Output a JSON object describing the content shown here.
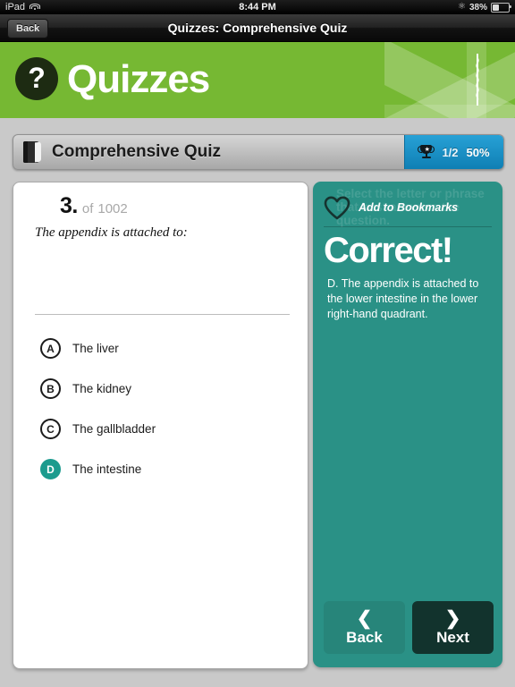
{
  "statusbar": {
    "device": "iPad",
    "wifi_icon": "wifi-icon",
    "time": "8:44 PM",
    "bluetooth_icon": "bluetooth-icon",
    "battery_percent": "38%"
  },
  "navbar": {
    "back_label": "Back",
    "title": "Quizzes: Comprehensive Quiz"
  },
  "brand": {
    "icon": "question-mark-icon",
    "icon_glyph": "?",
    "title": "Quizzes",
    "decoration_icon": "rod-of-asclepius-icon",
    "green": "#76b833"
  },
  "quizbar": {
    "book_icon": "book-icon",
    "name": "Comprehensive Quiz",
    "trophy_icon": "trophy-icon",
    "score_fraction": "1/2",
    "score_percent": "50%",
    "badge_blue": "#1a8fc4"
  },
  "question": {
    "number": "3.",
    "of_label": "of",
    "total": "1002",
    "text": "The appendix is attached to:",
    "options": [
      {
        "letter": "A",
        "label": "The liver",
        "selected": false
      },
      {
        "letter": "B",
        "label": "The kidney",
        "selected": false
      },
      {
        "letter": "C",
        "label": "The gallbladder",
        "selected": false
      },
      {
        "letter": "D",
        "label": "The intestine",
        "selected": true
      }
    ]
  },
  "answer_panel": {
    "ghost_text": "Select the letter or phrase that best answers the question.",
    "heart_icon": "heart-outline-icon",
    "bookmark_label": "Add to Bookmarks",
    "verdict": "Correct!",
    "explanation": "D. The appendix is attached to the lower intestine in the lower right-hand quadrant.",
    "teal": "#2a9186",
    "back_chevron": "chevron-left-icon",
    "back_label": "Back",
    "next_chevron": "chevron-right-icon",
    "next_label": "Next"
  }
}
